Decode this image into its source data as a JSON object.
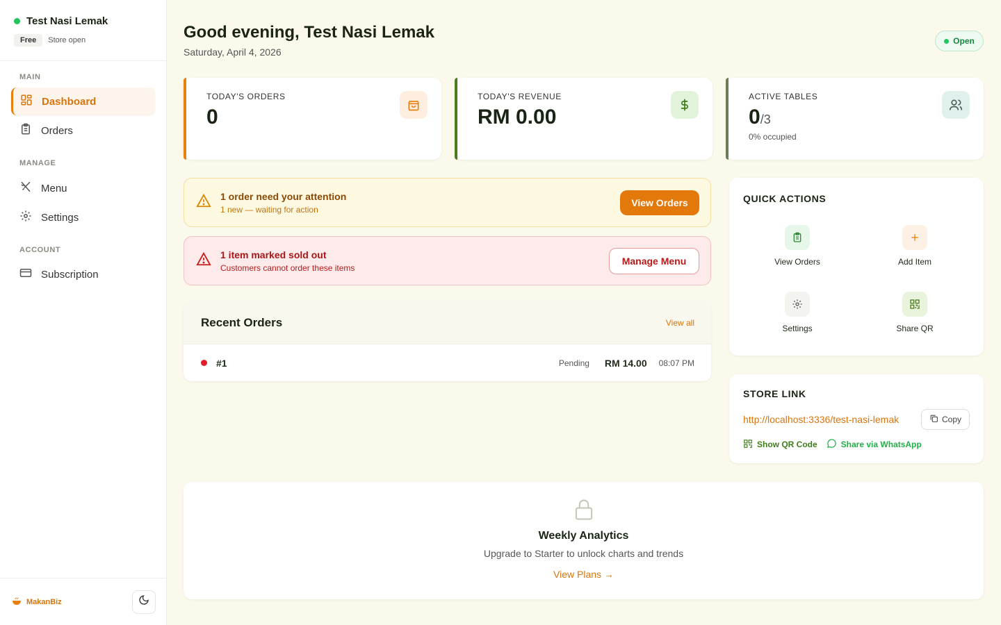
{
  "colors": {
    "accent": "#e3780b",
    "success": "#22c55e",
    "danger": "#e11d2c"
  },
  "sidebar": {
    "store_name": "Test Nasi Lemak",
    "plan_badge": "Free",
    "store_status": "Store open",
    "sections": {
      "main": "MAIN",
      "manage": "MANAGE",
      "account": "ACCOUNT"
    },
    "items": [
      {
        "label": "Dashboard",
        "icon": "dashboard-grid-icon",
        "active": true
      },
      {
        "label": "Orders",
        "icon": "clipboard-icon"
      },
      {
        "label": "Menu",
        "icon": "utensils-icon"
      },
      {
        "label": "Settings",
        "icon": "gear-icon"
      },
      {
        "label": "Subscription",
        "icon": "credit-card-icon"
      }
    ],
    "footer_brand": "MakanBiz"
  },
  "header": {
    "greeting": "Good evening, Test Nasi Lemak",
    "date": "Saturday, April 4, 2026",
    "status_pill": "Open"
  },
  "stats": [
    {
      "label": "TODAY'S ORDERS",
      "value": "0",
      "icon": "shopping-bag-icon"
    },
    {
      "label": "TODAY'S REVENUE",
      "value": "RM 0.00",
      "icon": "dollar-icon"
    },
    {
      "label": "ACTIVE TABLES",
      "value": "0",
      "value_suffix": "/3",
      "sub": "0% occupied",
      "icon": "users-icon"
    }
  ],
  "alerts": {
    "attention": {
      "title": "1 order need your attention",
      "subtitle": "1 new — waiting for action",
      "button": "View Orders"
    },
    "sold_out": {
      "title": "1 item marked sold out",
      "subtitle": "Customers cannot order these items",
      "button": "Manage Menu"
    }
  },
  "recent_orders": {
    "title": "Recent Orders",
    "view_all": "View all",
    "rows": [
      {
        "id": "#1",
        "status": "Pending",
        "amount": "RM 14.00",
        "time": "08:07 PM"
      }
    ]
  },
  "quick_actions": {
    "title": "QUICK ACTIONS",
    "items": [
      {
        "label": "View Orders",
        "icon": "clipboard-icon"
      },
      {
        "label": "Add Item",
        "icon": "plus-icon"
      },
      {
        "label": "Settings",
        "icon": "gear-icon"
      },
      {
        "label": "Share QR",
        "icon": "qr-code-icon"
      }
    ]
  },
  "store_link": {
    "title": "STORE LINK",
    "url": "http://localhost:3336/test-nasi-lemak",
    "copy": "Copy",
    "show_qr": "Show QR Code",
    "share_whatsapp": "Share via WhatsApp"
  },
  "analytics": {
    "title": "Weekly Analytics",
    "subtitle": "Upgrade to Starter to unlock charts and trends",
    "link": "View Plans →"
  }
}
